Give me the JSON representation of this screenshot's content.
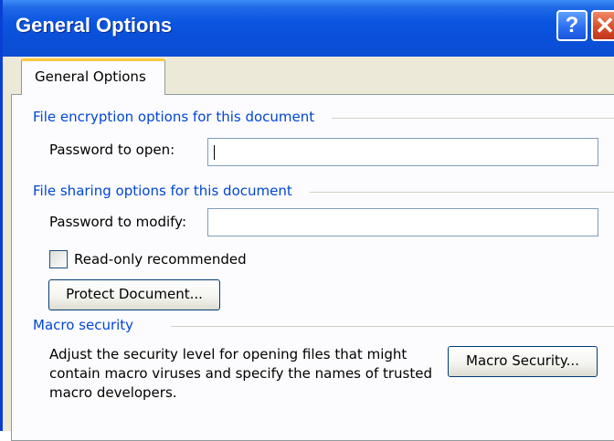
{
  "window": {
    "title": "General Options",
    "help_glyph": "?",
    "close_glyph": "✕"
  },
  "tabs": [
    {
      "label": "General Options",
      "selected": true
    }
  ],
  "encryption": {
    "heading": "File encryption options for this document",
    "password_open_label": "Password to open:",
    "password_open_value": ""
  },
  "sharing": {
    "heading": "File sharing options for this document",
    "password_modify_label": "Password to modify:",
    "password_modify_value": "",
    "readonly_label": "Read-only recommended",
    "readonly_checked": false,
    "protect_button": "Protect Document..."
  },
  "macro": {
    "heading": "Macro security",
    "description": "Adjust the security level for opening files that might contain macro viruses and specify the names of trusted macro developers.",
    "button": "Macro Security..."
  },
  "colors": {
    "title_bar": "#0a55e0",
    "group_heading": "#0046d5",
    "dialog_bg": "#ece9d8",
    "tab_highlight": "#ffc83c"
  }
}
